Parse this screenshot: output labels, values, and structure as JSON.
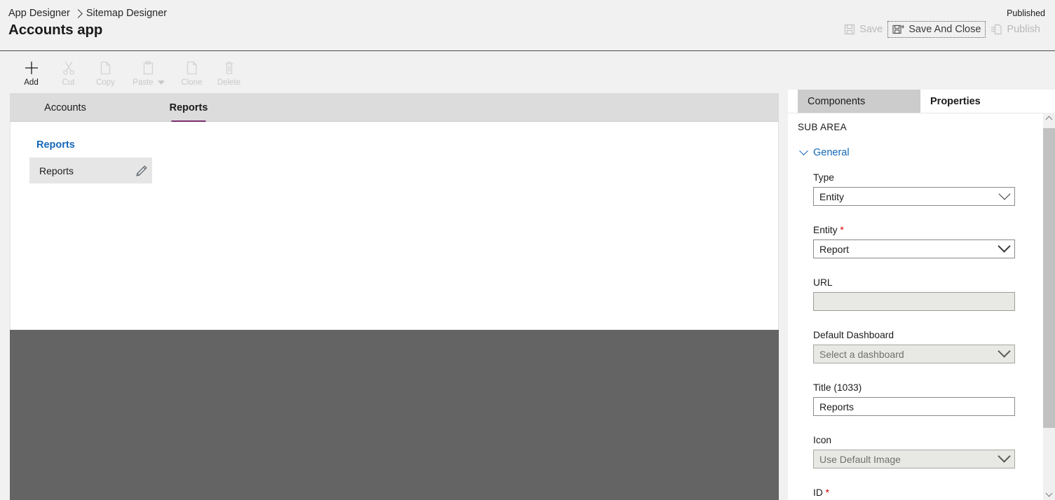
{
  "header": {
    "breadcrumb": [
      {
        "label": "App Designer",
        "icon": ""
      },
      {
        "label": "Sitemap Designer",
        "icon": ""
      }
    ],
    "breadcrumb_separator_icon": "chevron-right-icon",
    "app_title": "Accounts app",
    "published_state": "Published",
    "actions": [
      {
        "label": "Save",
        "icon": "save-icon",
        "enabled": false,
        "focused": false
      },
      {
        "label": "Save And Close",
        "icon": "save-and-close-icon",
        "enabled": true,
        "focused": true
      },
      {
        "label": "Publish",
        "icon": "publish-icon",
        "enabled": false,
        "focused": false
      }
    ]
  },
  "commandbar": {
    "items": [
      {
        "label": "Add",
        "icon": "plus-icon",
        "enabled": true,
        "has_caret": false
      },
      {
        "label": "Cut",
        "icon": "scissors-icon",
        "enabled": false,
        "has_caret": false
      },
      {
        "label": "Copy",
        "icon": "copy-icon",
        "enabled": false,
        "has_caret": false
      },
      {
        "label": "Paste",
        "icon": "clipboard-icon",
        "enabled": false,
        "has_caret": true
      },
      {
        "label": "Clone",
        "icon": "clone-icon",
        "enabled": false,
        "has_caret": false
      },
      {
        "label": "Delete",
        "icon": "trash-icon",
        "enabled": false,
        "has_caret": false
      }
    ]
  },
  "designer": {
    "area_tabs": [
      {
        "label": "Accounts",
        "selected": false
      },
      {
        "label": "Reports",
        "selected": true
      }
    ],
    "accent_color": "#7c2f72",
    "group": {
      "title": "Reports",
      "title_color": "#1668b8",
      "subareas": [
        {
          "label": "Reports",
          "edit_icon": "pencil-icon",
          "selected": true
        }
      ]
    }
  },
  "panel": {
    "tabs": [
      {
        "label": "Components",
        "active": false
      },
      {
        "label": "Properties",
        "active": true
      }
    ],
    "caption": "SUB AREA",
    "sections": [
      {
        "label": "General",
        "expanded": true,
        "chevron_icon": "chevron-down-icon",
        "color": "#1668b8"
      }
    ],
    "fields": [
      {
        "label": "Type",
        "required": false,
        "control": "dropdown",
        "value": "Entity",
        "placeholder": "",
        "disabled": false,
        "chevron_icon": "chevron-down-icon"
      },
      {
        "label": "Entity",
        "required": true,
        "control": "dropdown",
        "value": "Report",
        "placeholder": "",
        "disabled": false,
        "chevron_icon": "chevron-down-icon"
      },
      {
        "label": "URL",
        "required": false,
        "control": "text",
        "value": "",
        "placeholder": "",
        "disabled": true,
        "chevron_icon": ""
      },
      {
        "label": "Default Dashboard",
        "required": false,
        "control": "dropdown",
        "value": "",
        "placeholder": "Select a dashboard",
        "disabled": true,
        "chevron_icon": "chevron-down-icon"
      },
      {
        "label": "Title (1033)",
        "required": false,
        "control": "text",
        "value": "Reports",
        "placeholder": "",
        "disabled": false,
        "chevron_icon": ""
      },
      {
        "label": "Icon",
        "required": false,
        "control": "dropdown",
        "value": "",
        "placeholder": "Use Default Image",
        "disabled": true,
        "chevron_icon": "chevron-down-icon"
      },
      {
        "label": "ID",
        "required": true,
        "control": "none",
        "value": "",
        "placeholder": "",
        "disabled": false,
        "chevron_icon": ""
      }
    ],
    "scrollbar": {
      "up_icon": "chevron-up-icon",
      "down_icon": "chevron-down-icon"
    }
  },
  "colors": {
    "page_bg": "#f1f1f1",
    "canvas_bg": "#ffffff",
    "canvas_shade": "#646464",
    "tabstrip_bg": "#dcdcdc",
    "tile_bg": "#e6e6e6",
    "required_red": "#d60000",
    "link_blue": "#1668b8",
    "accent_purple": "#7c2f72"
  }
}
